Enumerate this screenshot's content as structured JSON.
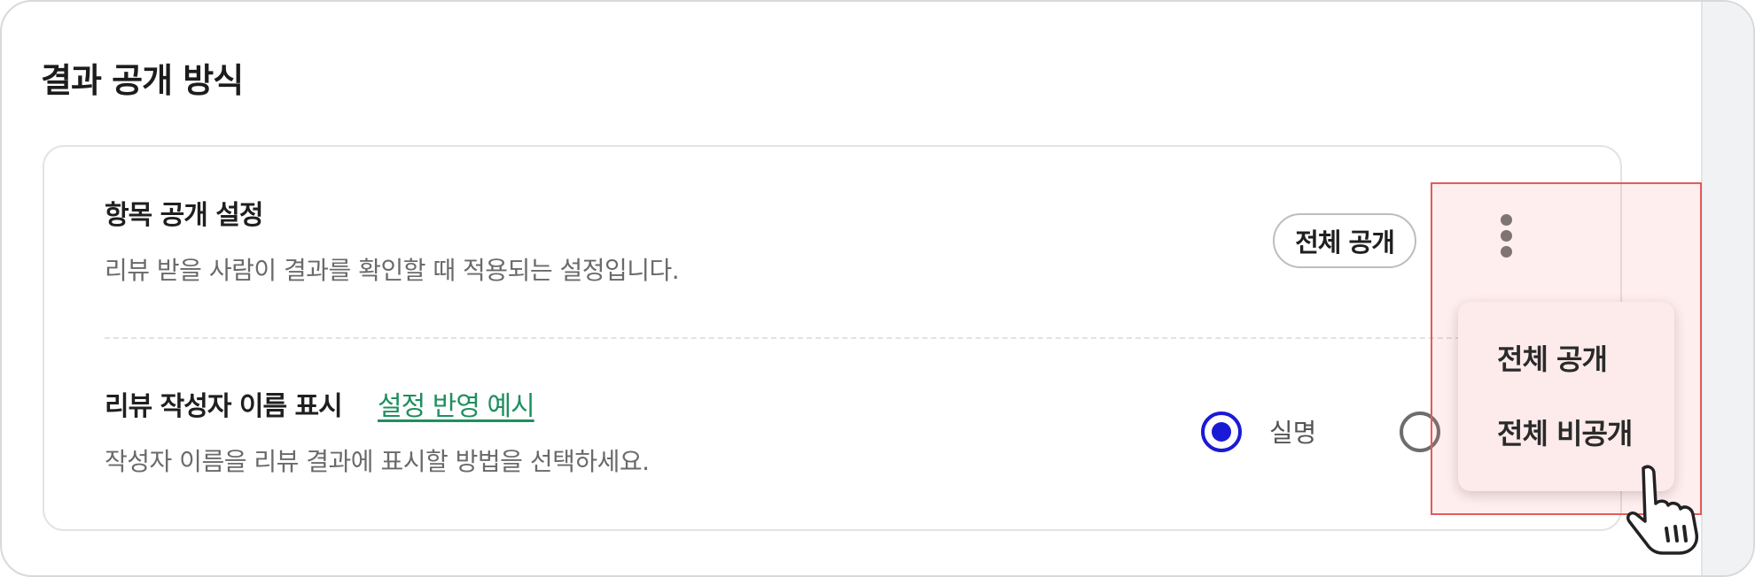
{
  "section": {
    "title": "결과 공개 방식"
  },
  "item_visibility": {
    "title": "항목 공개 설정",
    "description": "리뷰 받을 사람이 결과를 확인할 때 적용되는 설정입니다.",
    "current_value": "전체 공개",
    "more_icon": "kebab-vertical-icon",
    "menu": {
      "options": [
        "전체 공개",
        "전체 비공개"
      ]
    }
  },
  "author_name": {
    "title": "리뷰 작성자 이름 표시",
    "example_link": "설정 반영 예시",
    "description": "작성자 이름을 리뷰 결과에 표시할 방법을 선택하세요.",
    "options": [
      {
        "label": "실명",
        "selected": true
      },
      {
        "label": "",
        "selected": false
      }
    ]
  },
  "colors": {
    "radio_selected": "#1a1ad6",
    "link": "#1e8f5e",
    "highlight_border": "#e35b5b",
    "menu_bg": "#fdeaea"
  },
  "pointer": "hand-pointer-icon"
}
